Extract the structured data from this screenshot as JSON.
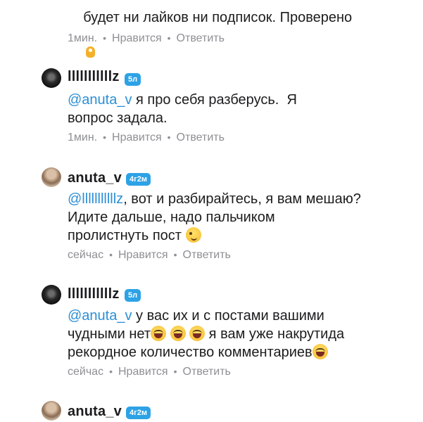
{
  "comments": [
    {
      "text_line": "будет ни лайков ни подписок. Проверено",
      "emoji": "ok-hand",
      "time": "1мин.",
      "like_label": "Нравится",
      "reply_label": "Ответить"
    },
    {
      "author": "lllllllllllz",
      "badge": "5л",
      "mention": "@anuta_v",
      "text_line1": " я про себя разберусь.  Я",
      "text_line2": "вопрос задала.",
      "time": "1мин.",
      "like_label": "Нравится",
      "reply_label": "Ответить"
    },
    {
      "author": "anuta_v",
      "badge": "4г2м",
      "mention": "@lllllllllllz",
      "text_line1": ", вот и разбирайтесь, я вам мешаю?",
      "text_line2": "Идите дальше, надо пальчиком",
      "text_line3": "пролистнуть пост",
      "emoji": "wink",
      "time": "сейчас",
      "like_label": "Нравится",
      "reply_label": "Ответить"
    },
    {
      "author": "lllllllllllz",
      "badge": "5л",
      "mention": "@anuta_v",
      "text_line1": " у вас их и с постами вашими",
      "text_line2a": "чудными нет",
      "text_line2b": " я вам уже накрутида",
      "text_line3": "рекордное количество комментариев",
      "emoji": "laughing",
      "time": "сейчас",
      "like_label": "Нравится",
      "reply_label": "Ответить"
    },
    {
      "author": "anuta_v",
      "badge": "4г2м"
    }
  ],
  "separator": "•",
  "colors": {
    "badge": "#2da2e6",
    "mention": "#2c8fd6",
    "meta": "#8d8f94"
  }
}
